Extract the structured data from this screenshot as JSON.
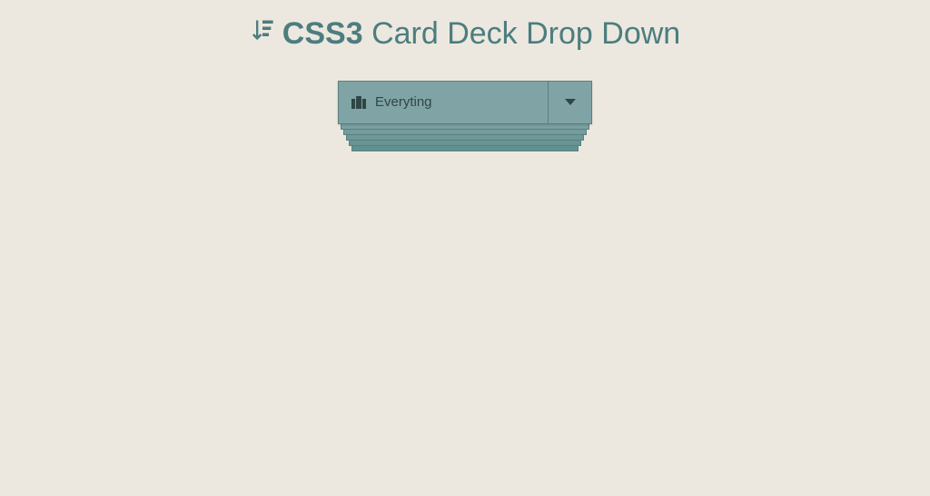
{
  "header": {
    "title_bold": "CSS3",
    "title_rest": "Card Deck Drop Down"
  },
  "dropdown": {
    "selected_label": "Everyting"
  },
  "colors": {
    "background": "#ece8df",
    "accent": "#4c7d7f",
    "card": "#80a4a5"
  }
}
